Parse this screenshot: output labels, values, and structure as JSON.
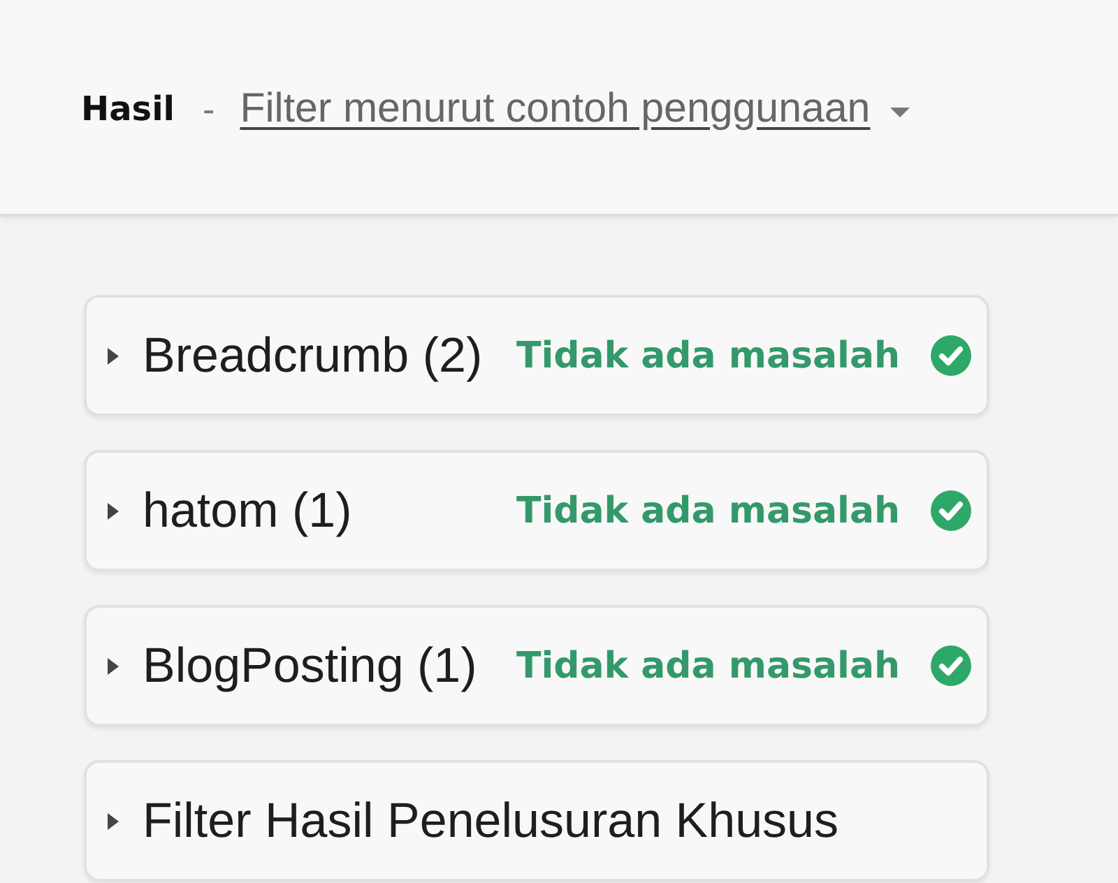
{
  "header": {
    "title": "Hasil",
    "separator": "-",
    "filter_link": "Filter menurut contoh penggunaan"
  },
  "results": [
    {
      "label": "Breadcrumb (2)",
      "expanded": false,
      "status": {
        "kind": "ok",
        "text": "Tidak ada masalah"
      }
    },
    {
      "label": "hatom (1)",
      "expanded": false,
      "status": {
        "kind": "ok",
        "text": "Tidak ada masalah"
      }
    },
    {
      "label": "BlogPosting (1)",
      "expanded": false,
      "status": {
        "kind": "ok",
        "text": "Tidak ada masalah"
      }
    },
    {
      "label": "Filter Hasil Penelusuran Khusus",
      "expanded": false
    }
  ]
}
